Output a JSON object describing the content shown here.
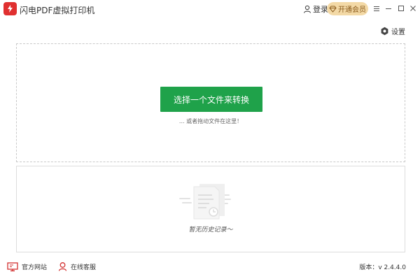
{
  "app": {
    "title": "闪电PDF虚拟打印机",
    "logo_icon": "lightning-pdf-logo",
    "brand_color": "#e03030"
  },
  "header": {
    "login_label": "登录",
    "vip_label": "开通会员",
    "vip_color": "#f3d9a6"
  },
  "toolbar": {
    "settings_label": "设置"
  },
  "dropzone": {
    "convert_button_label": "选择一个文件来转换",
    "hint": "... 或者拖动文件在这里！",
    "accent_color": "#1fa24a"
  },
  "history": {
    "empty_text": "暂无历史记录～"
  },
  "footer": {
    "website_label": "官方网站",
    "support_label": "在线客服",
    "version_text": "版本：v 2.4.4.0"
  }
}
